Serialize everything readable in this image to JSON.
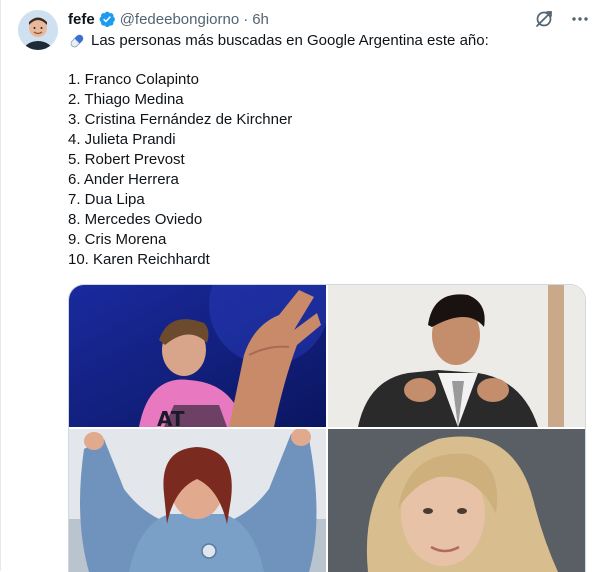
{
  "tweet": {
    "display_name": "fefe",
    "handle": "@fedeebongiorno",
    "separator": "·",
    "time": "6h",
    "text_first_line": "Las personas más buscadas en Google Argentina este año:",
    "list": [
      "1. Franco Colapinto",
      "2. Thiago Medina",
      "3. Cristina Fernández de Kirchner",
      "4. Julieta Prandi",
      "5. Robert Prevost",
      "6. Ander Herrera",
      "7. Dua Lipa",
      "8. Mercedes Oviedo",
      "9. Cris Morena",
      "10. Karen Reichhardt"
    ]
  },
  "icons": {
    "verified": "verified-badge-icon",
    "grok": "grok-icon",
    "more": "more-icon",
    "pill_emoji": "pill-emoji-icon"
  },
  "colors": {
    "verified_blue": "#1d9bf0",
    "secondary_text": "#536471",
    "primary_text": "#0f1419",
    "border": "#cfd9de"
  }
}
